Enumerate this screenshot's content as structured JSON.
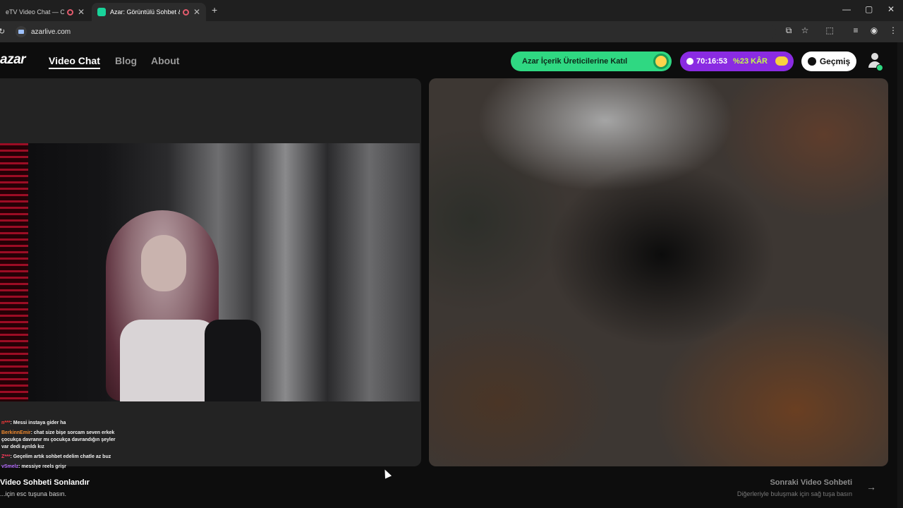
{
  "browser": {
    "tabs": [
      {
        "title": "eTV Video Chat — Ome",
        "active": false
      },
      {
        "title": "Azar: Görüntülü Sohbet & ",
        "active": true
      }
    ],
    "new_tab": "+",
    "url": "azarlive.com",
    "window_controls": {
      "minimize": "—",
      "maximize": "▢",
      "close": "✕"
    }
  },
  "header": {
    "logo": "azar",
    "nav": [
      "Video Chat",
      "Blog",
      "About"
    ],
    "creator_cta": "Azar İçerik Üreticilerine Katıl",
    "promo": {
      "timer": "70:16:53",
      "discount": "%23 KÂR"
    },
    "history_label": "Geçmiş"
  },
  "chat": [
    {
      "user": "n***",
      "text": "Messi instaya gider ha"
    },
    {
      "user": "BerkinnEmir",
      "text": "chat size bişe sorcam seven erkek çocukça davranır mı çocukça davrandığın şeyler var dedi ayrıldı kız"
    },
    {
      "user": "Z***",
      "text": "Geçelim artık sohbet edelim chatle az buz"
    },
    {
      "user": "vSmelz",
      "text": "messiye reels grişr"
    }
  ],
  "footer": {
    "end_title": "Video Sohbeti Sonlandır",
    "end_sub": "...için esc tuşuna basın.",
    "next_title": "Sonraki Video Sohbeti",
    "next_sub": "Diğerleriyle buluşmak için sağ tuşa basın",
    "next_arrow": "→"
  },
  "colors": {
    "green": "#2fd882",
    "purple": "#8a2be2",
    "bg": "#0d0d0d"
  }
}
